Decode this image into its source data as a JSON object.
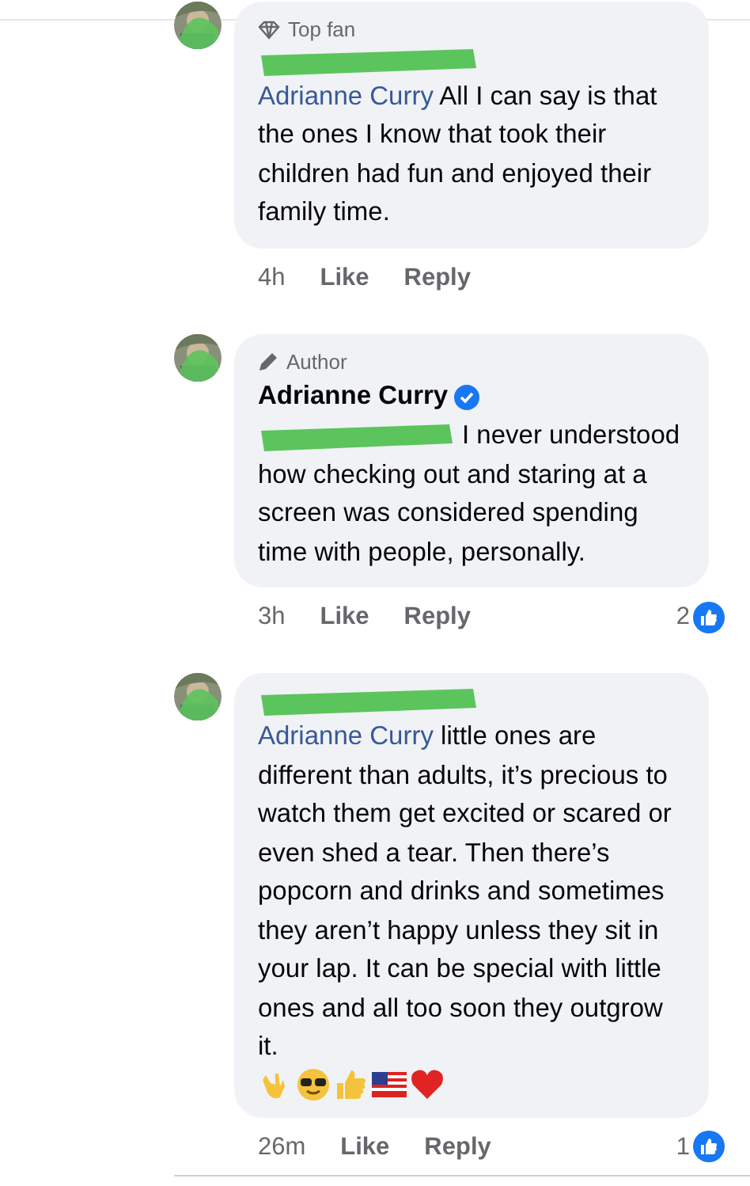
{
  "comments": [
    {
      "badge": {
        "kind": "top_fan",
        "label": "Top fan"
      },
      "author_redacted": true,
      "mention": "Adrianne Curry",
      "text": "All I can say is that the ones I know that took their children had fun and enjoyed their family time.",
      "time": "4h",
      "actions": [
        "Like",
        "Reply"
      ]
    },
    {
      "badge": {
        "kind": "author",
        "label": "Author"
      },
      "author": "Adrianne Curry",
      "verified": true,
      "mention_redacted": true,
      "text": "I never understood how checking out and staring at a screen was considered spending time with people, personally.",
      "time": "3h",
      "actions": [
        "Like",
        "Reply"
      ],
      "reaction_count": "2"
    },
    {
      "author_redacted": true,
      "mention": "Adrianne Curry",
      "text": "little ones are different than adults, it’s precious to watch them get excited or scared or even shed a tear. Then there’s popcorn and drinks and sometimes they aren’t happy unless they sit in your lap. It can be special with little ones and all too soon they outgrow it.",
      "emojis": [
        {
          "kind": "rock_hand"
        },
        {
          "kind": "sunglasses"
        },
        {
          "kind": "thumbs_up"
        },
        {
          "kind": "flag"
        },
        {
          "kind": "heart"
        }
      ],
      "time": "26m",
      "actions": [
        "Like",
        "Reply"
      ],
      "reaction_count": "1"
    }
  ]
}
